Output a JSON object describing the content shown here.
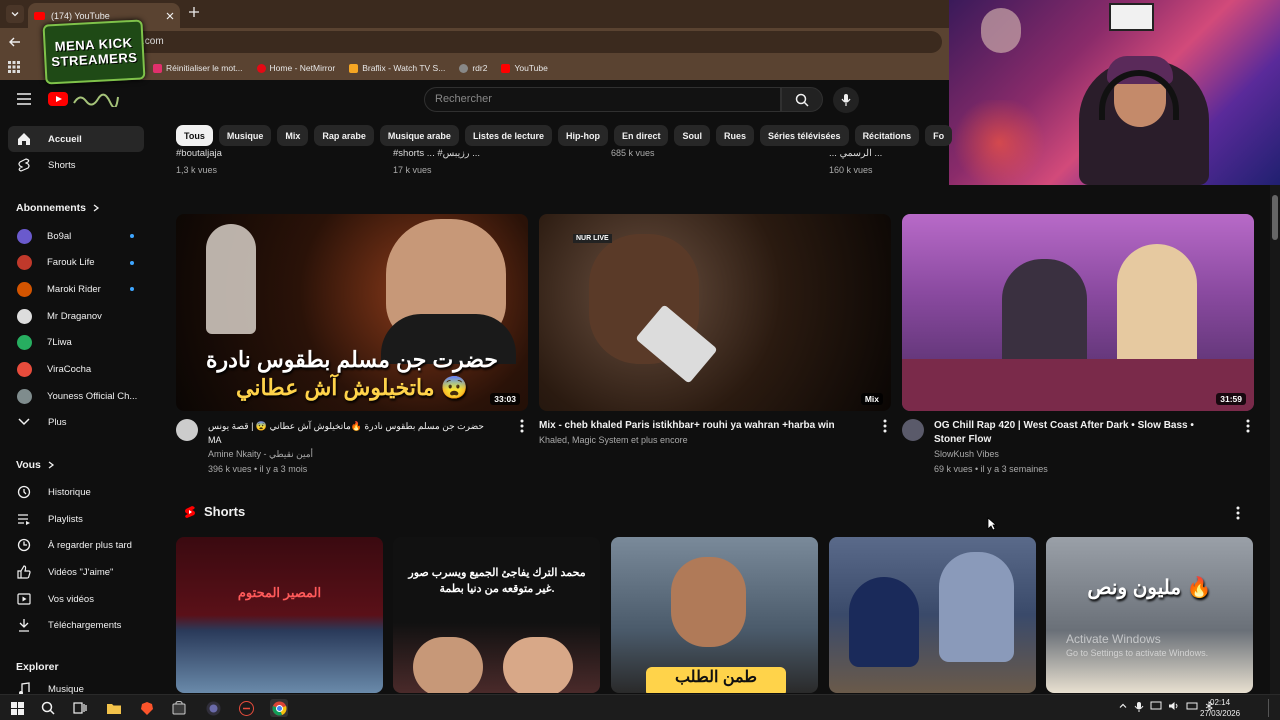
{
  "browser": {
    "tab_title": "(174) YouTube",
    "url": ".com",
    "bookmarks": [
      {
        "label": "Réinitialiser le mot...",
        "color": "#e1306c"
      },
      {
        "label": "Home - NetMirror",
        "color": "#e50914"
      },
      {
        "label": "Braflix - Watch TV S...",
        "color": "#f5a623"
      },
      {
        "label": "rdr2",
        "color": "#888888"
      },
      {
        "label": "YouTube",
        "color": "#ff0000"
      }
    ]
  },
  "overlay": {
    "logo_line1": "MENA KICK",
    "logo_line2": "STREAMERS"
  },
  "header": {
    "search_placeholder": "Rechercher"
  },
  "chips": [
    "Tous",
    "Musique",
    "Mix",
    "Rap arabe",
    "Musique arabe",
    "Listes de lecture",
    "Hip-hop",
    "En direct",
    "Soul",
    "Rues",
    "Séries télévisées",
    "Récitations",
    "Fo"
  ],
  "sidebar": {
    "home": "Accueil",
    "shorts": "Shorts",
    "subscriptions_title": "Abonnements",
    "subscriptions": [
      {
        "name": "Bo9al",
        "color": "#6a5acd",
        "new": true
      },
      {
        "name": "Farouk Life",
        "color": "#c0392b",
        "new": true
      },
      {
        "name": "Maroki Rider",
        "color": "#d35400",
        "new": true
      },
      {
        "name": "Mr Draganov",
        "color": "#dddddd",
        "new": false
      },
      {
        "name": "7Liwa",
        "color": "#27ae60",
        "new": false
      },
      {
        "name": "ViraCocha",
        "color": "#e74c3c",
        "new": false
      },
      {
        "name": "Youness Official Ch...",
        "color": "#7f8c8d",
        "new": false
      }
    ],
    "more": "Plus",
    "you_title": "Vous",
    "you_items": [
      "Historique",
      "Playlists",
      "À regarder plus tard",
      "Vidéos \"J'aime\"",
      "Vos vidéos",
      "Téléchargements"
    ],
    "explore_title": "Explorer",
    "explore_items": [
      "Musique"
    ]
  },
  "previous_row": [
    {
      "title": "#boutaljaja",
      "meta": "1,3 k vues"
    },
    {
      "title": "#shorts ... #رزيبس ...",
      "meta": "17 k vues"
    },
    {
      "title": "",
      "meta": "685 k vues"
    },
    {
      "title": "... الرسمي ...",
      "meta": "160 k vues"
    }
  ],
  "videos": [
    {
      "title": "حضرت جن مسلم بطقوس نادرة 🔥ماتخيلوش آش عطاني 😨 | قصة يونس MA",
      "channel": "Amine Nkaity - أمين نقيطي",
      "meta": "396 k vues • il y a 3 mois",
      "duration": "33:03",
      "thumb_text_line1": "حضرت جن مسلم بطقوس نادرة",
      "thumb_text_line2": "ماتخيلوش آش عطاني 😨"
    },
    {
      "title": "Mix - cheb khaled  Paris istikhbar+ rouhi ya wahran +harba win",
      "channel": "Khaled, Magic System et plus encore",
      "meta": "",
      "duration": "Mix",
      "badge": "NUR LIVE"
    },
    {
      "title": "OG Chill Rap 420 | West Coast After Dark • Slow Bass • Stoner Flow",
      "channel": "SlowKush Vibes",
      "meta": "69 k vues • il y a 3 semaines",
      "duration": "31:59"
    }
  ],
  "shorts": {
    "title": "Shorts",
    "items": [
      {
        "text": "المصير المحتوم"
      },
      {
        "text": "محمد الترك يفاجئ الجميع ويسرب صور غير متوقعه من دنيا بطمة."
      },
      {
        "text": "طمن الطلب"
      },
      {
        "text": ""
      },
      {
        "text": "مليون ونص 🔥"
      }
    ]
  },
  "watermark": {
    "line1": "Activate Windows",
    "line2": "Go to Settings to activate Windows."
  },
  "taskbar": {
    "time": "02:14",
    "date": "27/03/2026"
  }
}
